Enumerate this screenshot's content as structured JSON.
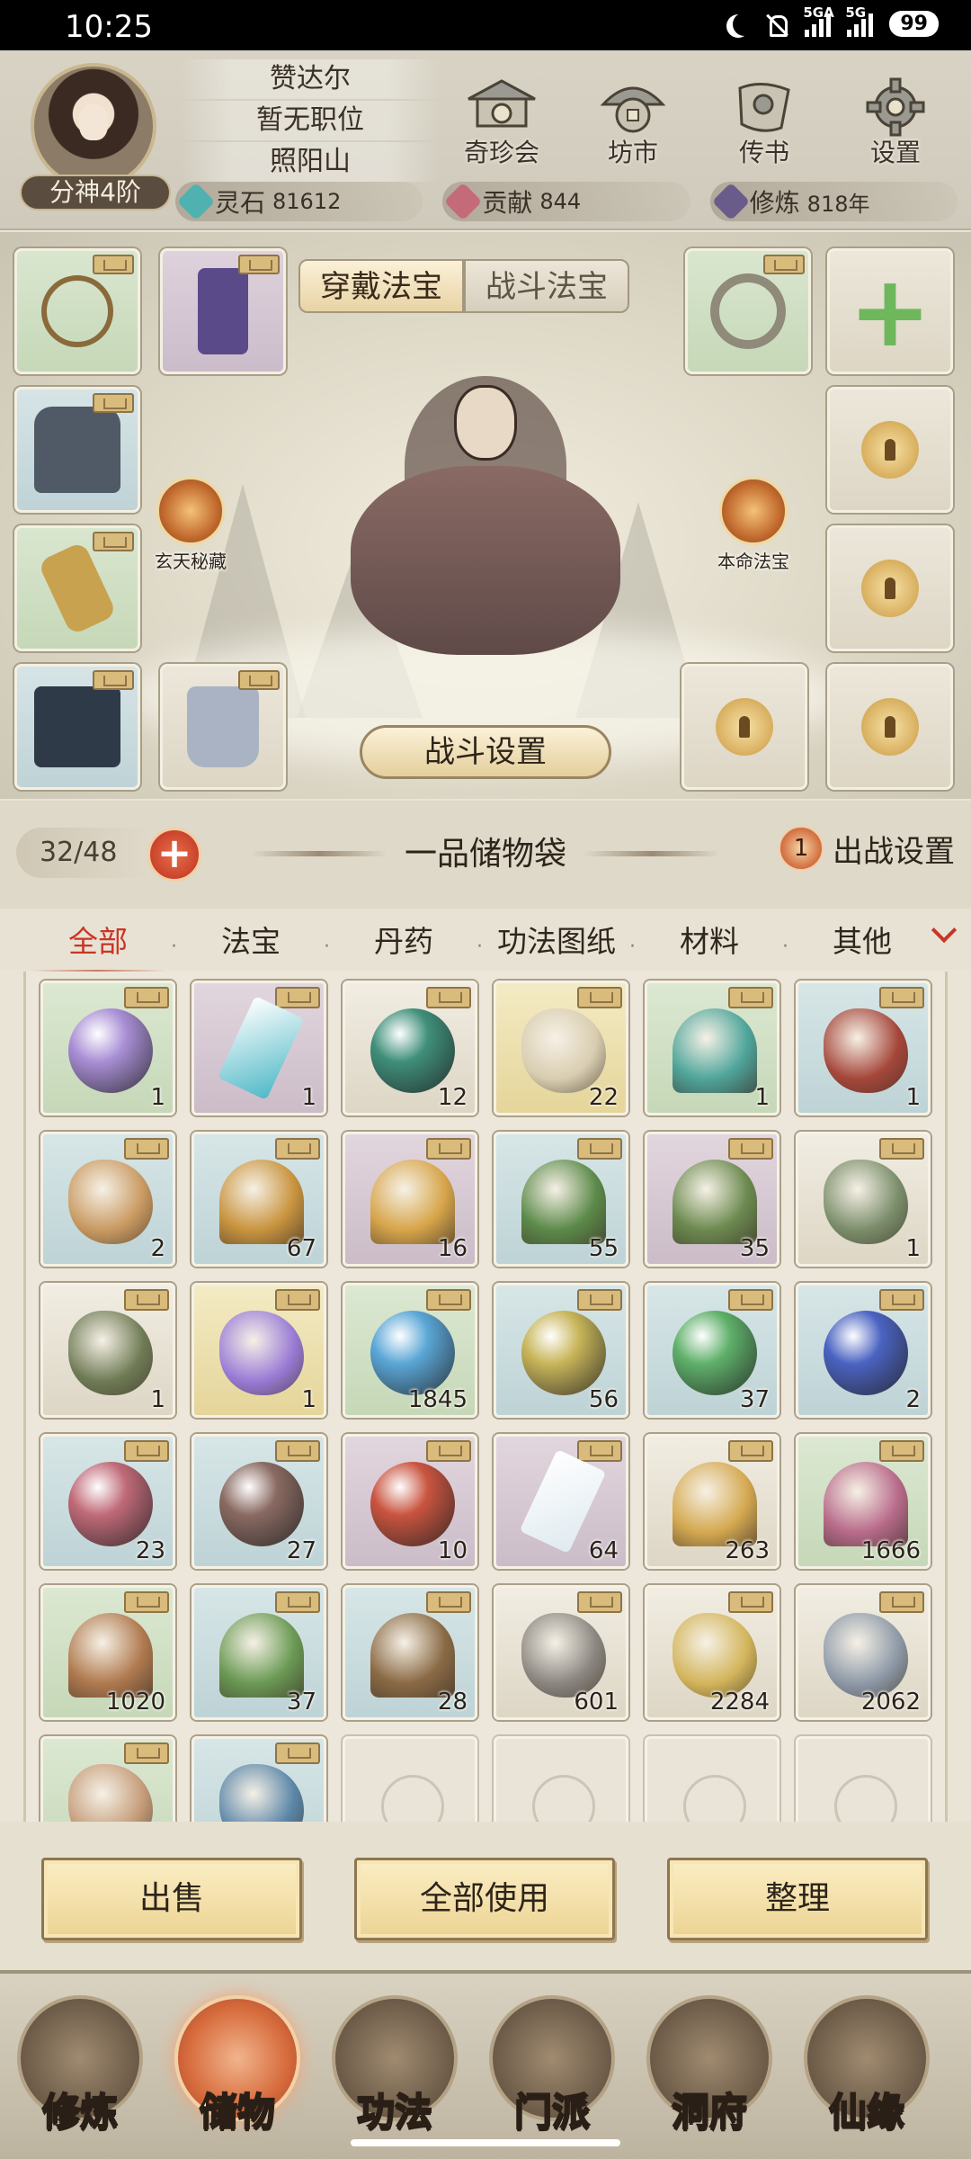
{
  "status": {
    "time": "10:25",
    "net1": "5GA",
    "net2": "5G",
    "battery": "99"
  },
  "profile": {
    "name": "赞达尔",
    "title": "暂无职位",
    "location": "照阳山",
    "rank": "分神4阶"
  },
  "top_menu": [
    {
      "label": "奇珍会",
      "icon": "treasure-pavilion-icon"
    },
    {
      "label": "坊市",
      "icon": "market-icon"
    },
    {
      "label": "传书",
      "icon": "scroll-letter-icon"
    },
    {
      "label": "设置",
      "icon": "gear-icon"
    }
  ],
  "resources": [
    {
      "label": "灵石",
      "value": "81612",
      "color": "#4fb2b0"
    },
    {
      "label": "贡献",
      "value": "844",
      "color": "#c46a78"
    },
    {
      "label": "修炼",
      "value": "818年",
      "color": "#6a5c8a"
    }
  ],
  "equip_tabs": {
    "active": "穿戴法宝",
    "inactive": "战斗法宝"
  },
  "side_badges": {
    "left": "玄天秘藏",
    "right": "本命法宝"
  },
  "battle_settings": "战斗设置",
  "bag": {
    "count": "32/48",
    "title": "一品储物袋",
    "sortie_num": "1",
    "sortie_label": "出战设置"
  },
  "categories": [
    "全部",
    "法宝",
    "丹药",
    "功法图纸",
    "材料",
    "其他"
  ],
  "items": [
    {
      "name": "pearl-on-cloth",
      "qty": "1",
      "rarity": "green",
      "art": "orb",
      "color": "#a98fd6"
    },
    {
      "name": "blue-crystal",
      "qty": "1",
      "rarity": "purple",
      "art": "shard",
      "color": "#4fb9c6"
    },
    {
      "name": "jade-orb",
      "qty": "12",
      "rarity": "white",
      "art": "orb",
      "color": "#3f8f7a"
    },
    {
      "name": "paper-scroll",
      "qty": "22",
      "rarity": "yellow",
      "art": "rock",
      "color": "#d9cdb0"
    },
    {
      "name": "teal-vase",
      "qty": "1",
      "rarity": "green",
      "art": "plant",
      "color": "#4fa59b"
    },
    {
      "name": "red-jar",
      "qty": "1",
      "rarity": "blue",
      "art": "rock",
      "color": "#a5463a"
    },
    {
      "name": "gourd-pouch",
      "qty": "2",
      "rarity": "blue",
      "art": "rock",
      "color": "#c99a62"
    },
    {
      "name": "golden-grass",
      "qty": "67",
      "rarity": "blue",
      "art": "plant",
      "color": "#c9943f"
    },
    {
      "name": "glowing-grass",
      "qty": "16",
      "rarity": "purple",
      "art": "plant",
      "color": "#d7a54a"
    },
    {
      "name": "green-herb",
      "qty": "55",
      "rarity": "blue",
      "art": "plant",
      "color": "#5c8a4a"
    },
    {
      "name": "sparkling-herb",
      "qty": "35",
      "rarity": "purple",
      "art": "plant",
      "color": "#6c8a50"
    },
    {
      "name": "jade-gauntlet",
      "qty": "1",
      "rarity": "white",
      "art": "rock",
      "color": "#7b8e6b"
    },
    {
      "name": "green-boots",
      "qty": "1",
      "rarity": "white",
      "art": "rock",
      "color": "#6f7b55"
    },
    {
      "name": "purple-cube",
      "qty": "1",
      "rarity": "yellow",
      "art": "rock",
      "color": "#9a7bd6"
    },
    {
      "name": "water-drop",
      "qty": "1845",
      "rarity": "green",
      "art": "orb",
      "color": "#5aa6d6"
    },
    {
      "name": "gold-orb",
      "qty": "56",
      "rarity": "blue",
      "art": "orb",
      "color": "#c8b559"
    },
    {
      "name": "green-orb",
      "qty": "37",
      "rarity": "blue",
      "art": "orb",
      "color": "#5fb06a"
    },
    {
      "name": "blue-orb",
      "qty": "2",
      "rarity": "blue",
      "art": "orb",
      "color": "#4b63c2"
    },
    {
      "name": "pink-orb",
      "qty": "23",
      "rarity": "blue",
      "art": "orb",
      "color": "#c06a78"
    },
    {
      "name": "brown-orb",
      "qty": "27",
      "rarity": "blue",
      "art": "orb",
      "color": "#8a6a62"
    },
    {
      "name": "fire-orb",
      "qty": "10",
      "rarity": "purple",
      "art": "orb",
      "color": "#c9543f"
    },
    {
      "name": "white-crystal",
      "qty": "64",
      "rarity": "purple",
      "art": "shard",
      "color": "#dfeaf0"
    },
    {
      "name": "ginseng-root",
      "qty": "263",
      "rarity": "white",
      "art": "plant",
      "color": "#d5a951"
    },
    {
      "name": "pink-flower",
      "qty": "1666",
      "rarity": "green",
      "art": "plant",
      "color": "#b86b8a"
    },
    {
      "name": "dried-root",
      "qty": "1020",
      "rarity": "green",
      "art": "plant",
      "color": "#b07a4f"
    },
    {
      "name": "white-flower",
      "qty": "37",
      "rarity": "blue",
      "art": "plant",
      "color": "#6b9a55"
    },
    {
      "name": "red-berry-branch",
      "qty": "28",
      "rarity": "blue",
      "art": "plant",
      "color": "#8a6a45"
    },
    {
      "name": "grey-stone",
      "qty": "601",
      "rarity": "white",
      "art": "rock",
      "color": "#8b8680"
    },
    {
      "name": "gold-ore",
      "qty": "2284",
      "rarity": "white",
      "art": "rock",
      "color": "#d3b55b"
    },
    {
      "name": "silver-ore",
      "qty": "2062",
      "rarity": "white",
      "art": "rock",
      "color": "#8e9aa8"
    },
    {
      "name": "tan-stone",
      "qty": "",
      "rarity": "green",
      "art": "rock",
      "color": "#c59d7a"
    },
    {
      "name": "blue-ore",
      "qty": "",
      "rarity": "blue",
      "art": "rock",
      "color": "#5b86a8"
    },
    {
      "name": "empty",
      "qty": "",
      "rarity": "empty",
      "art": "",
      "color": ""
    },
    {
      "name": "empty",
      "qty": "",
      "rarity": "empty",
      "art": "",
      "color": ""
    },
    {
      "name": "empty",
      "qty": "",
      "rarity": "empty",
      "art": "",
      "color": ""
    },
    {
      "name": "empty",
      "qty": "",
      "rarity": "empty",
      "art": "",
      "color": ""
    }
  ],
  "actions": {
    "sell": "出售",
    "use_all": "全部使用",
    "sort": "整理"
  },
  "bottom_nav": [
    {
      "label": "修炼",
      "active": false
    },
    {
      "label": "储物",
      "active": true
    },
    {
      "label": "功法",
      "active": false
    },
    {
      "label": "门派",
      "active": false
    },
    {
      "label": "洞府",
      "active": false
    },
    {
      "label": "仙缘",
      "active": false
    }
  ]
}
